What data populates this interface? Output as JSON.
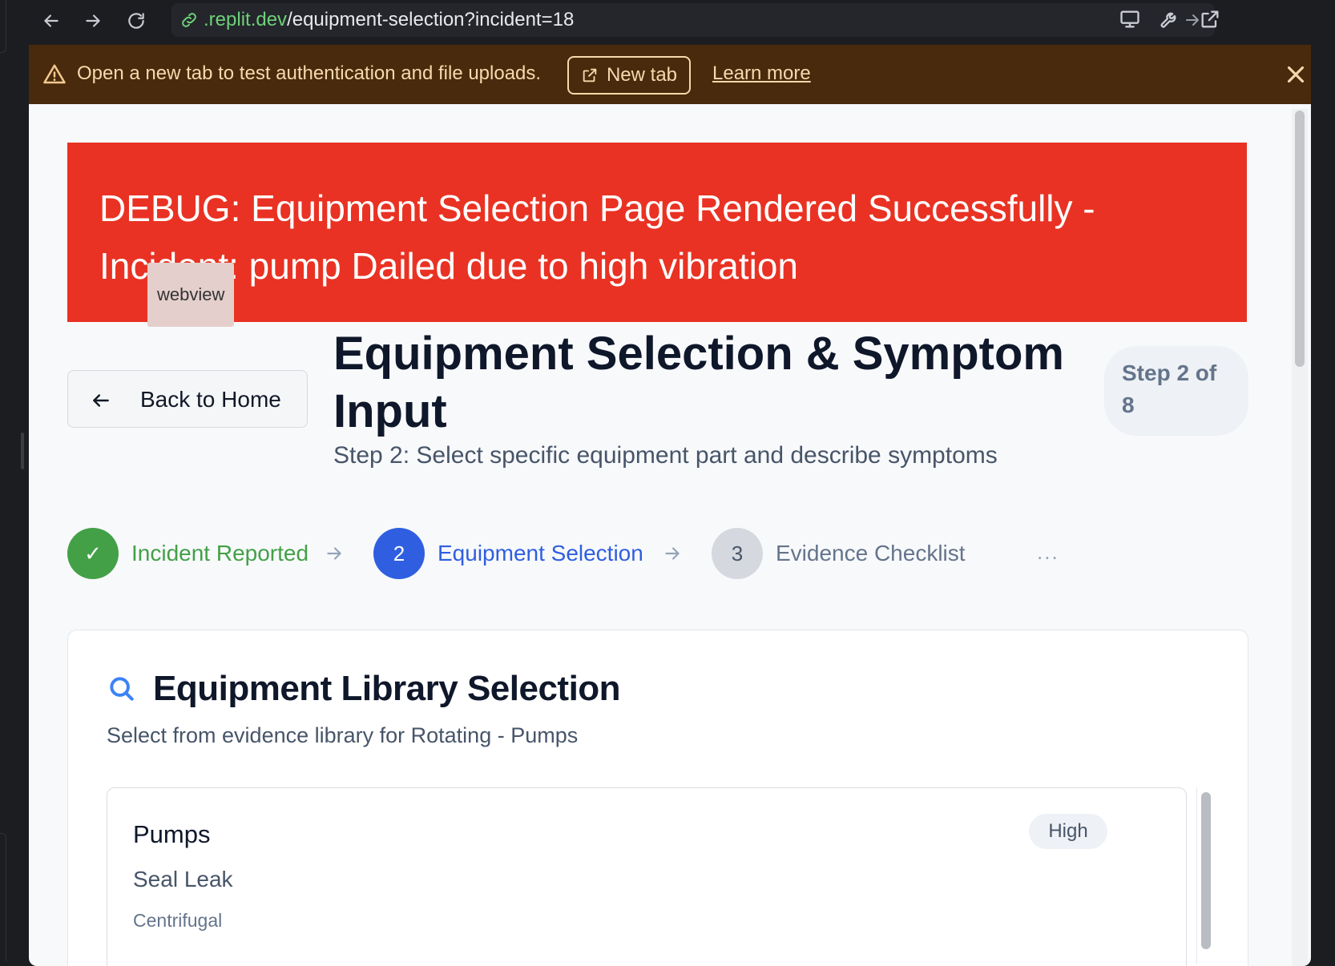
{
  "browser": {
    "url_domain": ".replit.dev",
    "url_path": "/equipment-selection?incident=18"
  },
  "banner": {
    "message": "Open a new tab to test authentication and file uploads.",
    "new_tab_label": "New tab",
    "learn_more_label": "Learn more"
  },
  "debug": {
    "line1": "DEBUG: Equipment Selection Page Rendered Successfully -",
    "line2": "Incident: pump Dailed due to high vibration",
    "tag": "webview"
  },
  "header": {
    "back_label": "Back to Home",
    "title": "Equipment Selection & Symptom Input",
    "subtitle": "Step 2: Select specific equipment part and describe symptoms",
    "step_badge": "Step 2 of 8"
  },
  "stepper": {
    "steps": [
      {
        "marker": "✓",
        "label": "Incident Reported",
        "state": "done"
      },
      {
        "marker": "2",
        "label": "Equipment Selection",
        "state": "active"
      },
      {
        "marker": "3",
        "label": "Evidence Checklist",
        "state": "pending"
      }
    ],
    "more": "..."
  },
  "library": {
    "title": "Equipment Library Selection",
    "description": "Select from evidence library for Rotating - Pumps",
    "items": [
      {
        "name": "Pumps",
        "component": "Seal Leak",
        "type": "Centrifugal",
        "priority": "High"
      }
    ]
  },
  "colors": {
    "debug_bg": "#e93223",
    "done": "#43a047",
    "active": "#2f5fe0",
    "pending": "#d5d9df",
    "banner_bg": "#4a2a0c",
    "url_domain": "#6fd07a"
  }
}
